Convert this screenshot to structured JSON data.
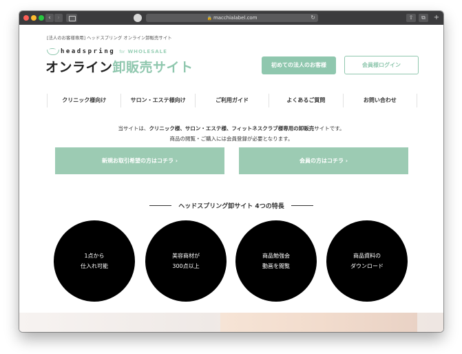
{
  "browser": {
    "url": "macchialabel.com",
    "back_glyph": "‹",
    "forward_glyph": "›",
    "reload_glyph": "↻",
    "lock_glyph": "🔒",
    "share_glyph": "⇧",
    "tabs_glyph": "⧉",
    "newtab_glyph": "+"
  },
  "header": {
    "tagline": "[法人のお客様専用] ヘッドスプリング オンライン卸販売サイト",
    "brand_word": "headspring",
    "brand_for": "for",
    "brand_wholesale": "WHOLESALE",
    "title_dark": "オンライン",
    "title_green": "卸販売サイト",
    "new_customer_button": "初めての法人のお客様",
    "login_button": "会員様ログイン"
  },
  "nav": {
    "items": [
      "クリニック様向け",
      "サロン・エステ様向け",
      "ご利用ガイド",
      "よくあるご質問",
      "お問い合わせ"
    ]
  },
  "intro": {
    "line1_prefix": "当サイトは、",
    "line1_bold": "クリニック様、サロン・エステ様、フィットネスクラブ様専用の卸販売",
    "line1_suffix": "サイトです。",
    "line2": "商品の閲覧・ご購入には会員登録が必要となります。"
  },
  "cta": {
    "left": "新規お取引希望の方はコチラ ›",
    "right": "会員の方はコチラ ›"
  },
  "features": {
    "heading": "ヘッドスプリング卸サイト 4つの特長",
    "items": [
      {
        "line1": "1点から",
        "line2": "仕入れ可能"
      },
      {
        "line1": "美容商材が",
        "line2": "300点以上"
      },
      {
        "line1": "商品勉強会",
        "line2": "動画を閲覧"
      },
      {
        "line1": "商品資料の",
        "line2": "ダウンロード"
      }
    ]
  },
  "colors": {
    "brand_green": "#8fc7ae",
    "cta_green": "#9ccbb3",
    "feature_circle": "#000000"
  }
}
